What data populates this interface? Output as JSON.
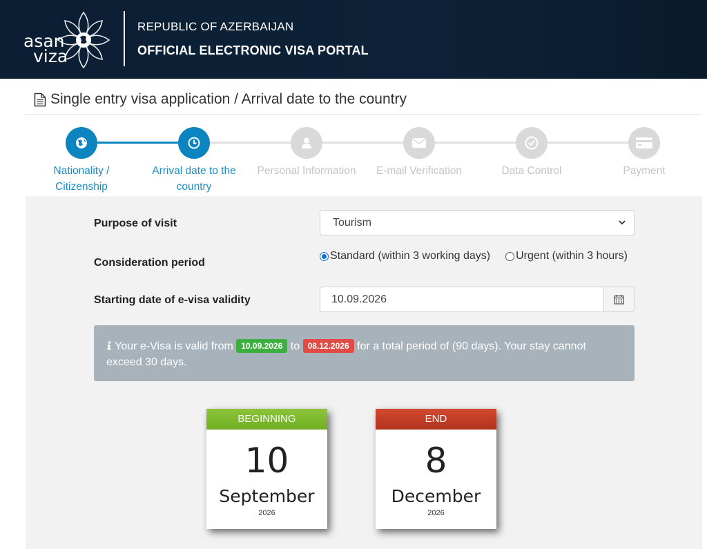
{
  "header": {
    "logo_line1": "asan",
    "logo_line2": "viza",
    "country": "REPUBLIC OF AZERBAIJAN",
    "portal": "OFFICIAL ELECTRONIC VISA PORTAL"
  },
  "page_title": "Single entry visa application / Arrival date to the country",
  "steps": [
    {
      "line1": "Nationality /",
      "line2": "Citizenship",
      "icon": "globe-icon",
      "state": "done"
    },
    {
      "line1": "Arrival date to the",
      "line2": "country",
      "icon": "clock-icon",
      "state": "current"
    },
    {
      "line1": "Personal Information",
      "line2": "",
      "icon": "user-icon",
      "state": "pending"
    },
    {
      "line1": "E-mail Verification",
      "line2": "",
      "icon": "envelope-icon",
      "state": "pending"
    },
    {
      "line1": "Data Control",
      "line2": "",
      "icon": "check-circle-icon",
      "state": "pending"
    },
    {
      "line1": "Payment",
      "line2": "",
      "icon": "credit-card-icon",
      "state": "pending"
    }
  ],
  "form": {
    "purpose_label": "Purpose of visit",
    "purpose_value": "Tourism",
    "period_label": "Consideration period",
    "period_standard": "Standard (within 3 working days)",
    "period_urgent": "Urgent (within 3 hours)",
    "period_selected": "standard",
    "start_label": "Starting date of e-visa validity",
    "start_value": "10.09.2026"
  },
  "info": {
    "part1": "Your e-Visa is valid from",
    "from": "10.09.2026",
    "part2": "to",
    "to": "08.12.2026",
    "part3": "for a total period of (90 days). Your stay cannot exceed 30 days."
  },
  "cards": {
    "begin": {
      "label": "BEGINNING",
      "day": "10",
      "month": "September",
      "year": "2026"
    },
    "end": {
      "label": "END",
      "day": "8",
      "month": "December",
      "year": "2026"
    }
  },
  "colors": {
    "header_bg": "#0d2238",
    "accent": "#0b84c0",
    "badge_green": "#3bb03f",
    "badge_red": "#e14b44",
    "info_bg": "#a7b2bb"
  }
}
